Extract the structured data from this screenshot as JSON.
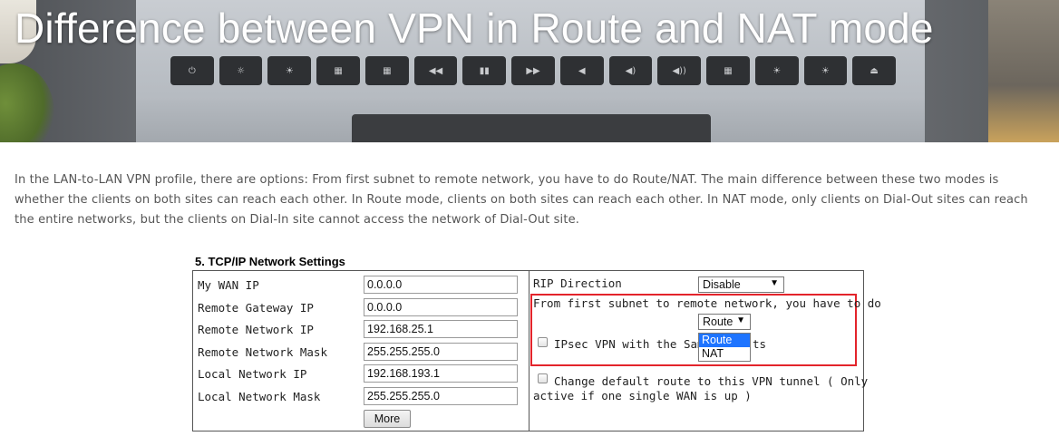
{
  "hero": {
    "title": "Difference between VPN in Route and NAT mode",
    "key_icons": [
      "⏻",
      "☼",
      "☀",
      "▦",
      "▦",
      "◀◀",
      "▮▮",
      "▶▶",
      "◀",
      "◀)",
      "◀))",
      "▦",
      "☀",
      "☀",
      "⏏"
    ]
  },
  "intro": {
    "text": "In the LAN-to-LAN VPN profile, there are options: From first subnet to remote network, you have to do Route/NAT. The main difference between these two modes is whether the clients on both sites can reach each other. In Route mode, clients on both sites can reach each other. In NAT mode, only clients on Dial-Out sites can reach the entire networks, but the clients on Dial-In site cannot access the network of Dial-Out site."
  },
  "settings": {
    "section_title": "5. TCP/IP Network Settings",
    "fields": [
      {
        "label": "My WAN IP",
        "value": "0.0.0.0"
      },
      {
        "label": "Remote Gateway IP",
        "value": "0.0.0.0"
      },
      {
        "label": "Remote Network IP",
        "value": "192.168.25.1"
      },
      {
        "label": "Remote Network Mask",
        "value": "255.255.255.0"
      },
      {
        "label": "Local Network IP",
        "value": "192.168.193.1"
      },
      {
        "label": "Local Network Mask",
        "value": "255.255.255.0"
      }
    ],
    "more_button": "More",
    "rip_direction_label": "RIP Direction",
    "rip_direction_value": "Disable",
    "route_nat_text": "From first subnet to remote network, you have to do",
    "route_nat_value": "Route",
    "route_nat_options": [
      "Route",
      "NAT"
    ],
    "ipsec_label_start": "IPsec VPN with the Sam",
    "ipsec_label_end": "ts",
    "default_route_line1": "Change default route to this VPN tunnel ( Only",
    "default_route_line2": "active if one single WAN is up )",
    "accent_color": "#e3242b",
    "selected_option_color": "#1e74ff"
  }
}
